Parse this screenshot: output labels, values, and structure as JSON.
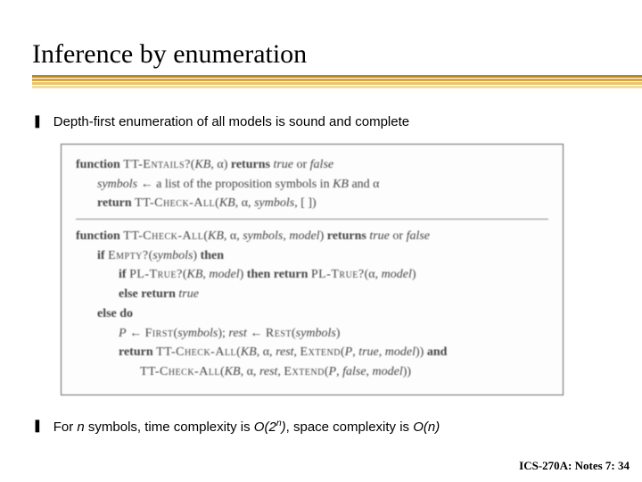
{
  "slide": {
    "title": "Inference by enumeration",
    "bullets": [
      {
        "text": "Depth-first enumeration of all models is sound and complete"
      },
      {
        "text_html": "For <em class='var'>n</em> symbols, time complexity is <em class='var'>O(2<sup>n</sup>)</em>, space complexity is <em class='var'>O(n)</em>"
      }
    ],
    "footer": "ICS-270A: Notes 7: 34"
  },
  "pseudocode": {
    "func1": {
      "signature_html": "<span class='fn'>function</span> <span class='sc'>TT-Entails?</span>(<span class='ital'>KB</span>, α) <span class='fn'>returns</span> <span class='ital'>true</span> or <span class='ital'>false</span>",
      "line1_html": "<span class='ital'>symbols</span> ← a list of the proposition symbols in <span class='ital'>KB</span> and α",
      "line2_html": "<span class='fn'>return</span> <span class='sc'>TT-Check-All</span>(<span class='ital'>KB</span>, α, <span class='ital'>symbols</span>, [ ])"
    },
    "func2": {
      "signature_html": "<span class='fn'>function</span> <span class='sc'>TT-Check-All</span>(<span class='ital'>KB</span>, α, <span class='ital'>symbols</span>, <span class='ital'>model</span>) <span class='fn'>returns</span> <span class='ital'>true</span> or <span class='ital'>false</span>",
      "line1_html": "<span class='fn'>if</span> <span class='sc'>Empty?</span>(<span class='ital'>symbols</span>) <span class='fn'>then</span>",
      "line2_html": "<span class='fn'>if</span> <span class='sc'>PL-True?</span>(<span class='ital'>KB</span>, <span class='ital'>model</span>) <span class='fn'>then return</span> <span class='sc'>PL-True?</span>(α, <span class='ital'>model</span>)",
      "line3_html": "<span class='fn'>else return</span> <span class='ital'>true</span>",
      "line4_html": "<span class='fn'>else do</span>",
      "line5_html": "<span class='ital'>P</span> ← <span class='sc'>First</span>(<span class='ital'>symbols</span>); <span class='ital'>rest</span> ← <span class='sc'>Rest</span>(<span class='ital'>symbols</span>)",
      "line6_html": "<span class='fn'>return</span> <span class='sc'>TT-Check-All</span>(<span class='ital'>KB</span>, α, <span class='ital'>rest</span>, <span class='sc'>Extend</span>(<span class='ital'>P</span>, <span class='ital'>true</span>, <span class='ital'>model</span>)) <span class='fn'>and</span>",
      "line7_html": "<span class='sc'>TT-Check-All</span>(<span class='ital'>KB</span>, α, <span class='ital'>rest</span>, <span class='sc'>Extend</span>(<span class='ital'>P</span>, <span class='ital'>false</span>, <span class='ital'>model</span>))"
    }
  },
  "colors": {
    "stripes": [
      "#b88923",
      "#d9a63b",
      "#e9c469",
      "#f3dca0"
    ]
  }
}
